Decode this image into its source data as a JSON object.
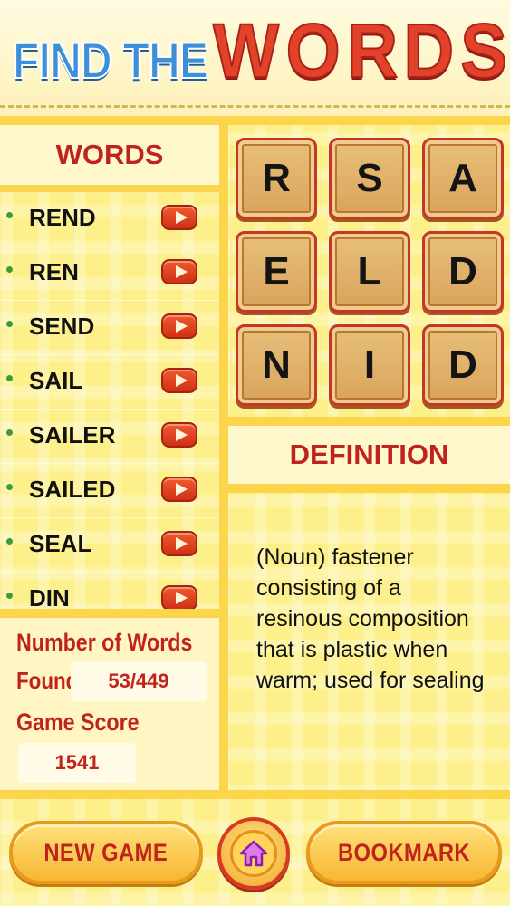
{
  "header": {
    "title_prefix": "FIND THE",
    "title_main_letters": [
      "W",
      "O",
      "R",
      "D",
      "S"
    ]
  },
  "words_panel": {
    "title": "WORDS",
    "items": [
      {
        "word": "REND",
        "play_icon": "play-icon"
      },
      {
        "word": "REN",
        "play_icon": "play-icon"
      },
      {
        "word": "SEND",
        "play_icon": "play-icon"
      },
      {
        "word": "SAIL",
        "play_icon": "play-icon"
      },
      {
        "word": "SAILER",
        "play_icon": "play-icon"
      },
      {
        "word": "SAILED",
        "play_icon": "play-icon"
      },
      {
        "word": "SEAL",
        "play_icon": "play-icon"
      },
      {
        "word": "DIN",
        "play_icon": "play-icon"
      }
    ]
  },
  "stats": {
    "number_of_words_label": "Number of Words",
    "found_label": "Found",
    "found_value": "53/449",
    "game_score_label": "Game Score",
    "game_score_value": "1541"
  },
  "board": {
    "tiles": [
      "R",
      "S",
      "A",
      "E",
      "L",
      "D",
      "N",
      "I",
      "D"
    ]
  },
  "definition": {
    "title": "DEFINITION",
    "text": "(Noun) fastener consisting of a resinous composition that is plastic when warm; used for sealing"
  },
  "footer": {
    "new_game_label": "NEW GAME",
    "bookmark_label": "BOOKMARK",
    "home_icon": "home-icon"
  },
  "colors": {
    "accent_red": "#c0231c",
    "title_blue": "#3d8fd9",
    "title_red": "#e2422a",
    "background_yellow": "#fdf08a",
    "divider_yellow": "#fdd54a",
    "home_icon_purple": "#b03ad8"
  }
}
